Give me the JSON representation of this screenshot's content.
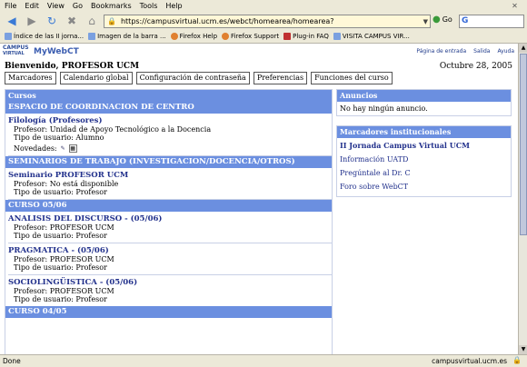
{
  "browser": {
    "menu": [
      "File",
      "Edit",
      "View",
      "Go",
      "Bookmarks",
      "Tools",
      "Help"
    ],
    "url": "https://campusvirtual.ucm.es/webct/homearea/homearea?",
    "go_label": "Go",
    "search_glyph": "G",
    "bookmarks": [
      {
        "label": "Índice de las II jorna...",
        "color": "#7aa0e0"
      },
      {
        "label": "Imagen de la barra ...",
        "color": "#7aa0e0"
      },
      {
        "label": "Firefox Help",
        "color": "#e08030"
      },
      {
        "label": "Firefox Support",
        "color": "#e08030"
      },
      {
        "label": "Plug-in FAQ",
        "color": "#c03030"
      },
      {
        "label": "VISITA CAMPUS VIR...",
        "color": "#7aa0e0"
      }
    ],
    "status": "Done",
    "status_host": "campusvirtual.ucm.es"
  },
  "header": {
    "logo_line1": "CAMPUS",
    "logo_line2": "VIRTUAL",
    "product": "MyWebCT",
    "links": [
      "Página de entrada",
      "Salida",
      "Ayuda"
    ]
  },
  "page": {
    "welcome": "Bienvenido, PROFESOR UCM",
    "date": "Octubre 28, 2005",
    "buttons": [
      "Marcadores",
      "Calendario global",
      "Configuración de contraseña",
      "Preferencias",
      "Funciones del curso"
    ]
  },
  "cursos": {
    "title": "Cursos",
    "groups": [
      {
        "name": "ESPACIO DE COORDINACION DE CENTRO",
        "courses": [
          {
            "title": "Filología (Profesores)",
            "profesor": "Profesor: Unidad de Apoyo Tecnológico a la Docencia",
            "tipo": "Tipo de usuario: Alumno",
            "novedades": "Novedades:"
          }
        ]
      },
      {
        "name": "SEMINARIOS DE TRABAJO (INVESTIGACION/DOCENCIA/OTROS)",
        "courses": [
          {
            "title": "Seminario PROFESOR UCM",
            "profesor": "Profesor: No está disponible",
            "tipo": "Tipo de usuario: Profesor"
          }
        ]
      },
      {
        "name": "CURSO 05/06",
        "courses": [
          {
            "title": "ANALISIS DEL DISCURSO - (05/06)",
            "profesor": "Profesor: PROFESOR UCM",
            "tipo": "Tipo de usuario: Profesor"
          },
          {
            "title": "PRAGMATICA - (05/06)",
            "profesor": "Profesor: PROFESOR UCM",
            "tipo": "Tipo de usuario: Profesor"
          },
          {
            "title": "SOCIOLINGÜISTICA - (05/06)",
            "profesor": "Profesor: PROFESOR UCM",
            "tipo": "Tipo de usuario: Profesor"
          }
        ]
      },
      {
        "name": "CURSO 04/05",
        "courses": []
      }
    ]
  },
  "anuncios": {
    "title": "Anuncios",
    "text": "No hay ningún anuncio."
  },
  "marcadores": {
    "title": "Marcadores institucionales",
    "links": [
      "II Jornada Campus Virtual UCM",
      "Información UATD",
      "Pregúntale al Dr. C",
      "Foro sobre WebCT"
    ]
  }
}
